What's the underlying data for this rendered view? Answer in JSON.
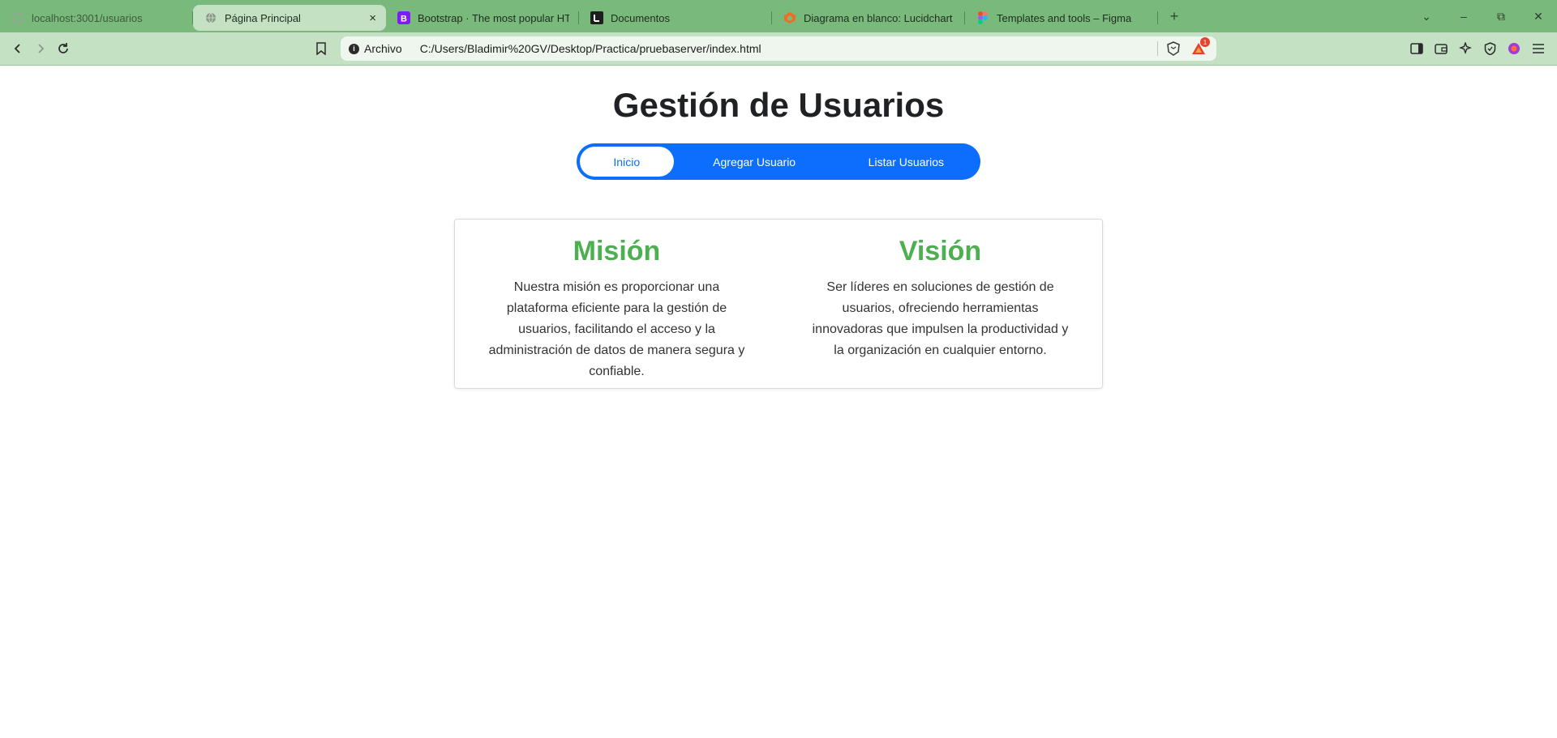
{
  "browser": {
    "tabs": [
      {
        "title": "localhost:3001/usuarios",
        "icon": "globe-icon",
        "active": false
      },
      {
        "title": "Página Principal",
        "icon": "globe-icon",
        "active": true
      },
      {
        "title": "Bootstrap · The most popular HTML",
        "icon": "bootstrap-icon",
        "active": false
      },
      {
        "title": "Documentos",
        "icon": "notion-icon",
        "active": false
      },
      {
        "title": "Diagrama en blanco: Lucidchart",
        "icon": "lucidchart-icon",
        "active": false
      },
      {
        "title": "Templates and tools – Figma",
        "icon": "figma-icon",
        "active": false
      }
    ],
    "close_tab_symbol": "×",
    "new_tab_symbol": "+",
    "url_scheme_label": "Archivo",
    "url": "C:/Users/Bladimir%20GV/Desktop/Practica/pruebaserver/index.html",
    "rewards_badge": "1"
  },
  "page": {
    "title": "Gestión de Usuarios",
    "nav": [
      {
        "label": "Inicio",
        "active": true
      },
      {
        "label": "Agregar Usuario",
        "active": false
      },
      {
        "label": "Listar Usuarios",
        "active": false
      }
    ],
    "mission": {
      "heading": "Misión",
      "text": "Nuestra misión es proporcionar una plataforma eficiente para la gestión de usuarios, facilitando el acceso y la administración de datos de manera segura y confiable."
    },
    "vision": {
      "heading": "Visión",
      "text": "Ser líderes en soluciones de gestión de usuarios, ofreciendo herramientas innovadoras que impulsen la productividad y la organización en cualquier entorno."
    }
  },
  "colors": {
    "tabstrip": "#79b97b",
    "toolbar": "#c4e1c3",
    "nav_primary": "#0d6efd",
    "heading_green": "#4caf50"
  }
}
